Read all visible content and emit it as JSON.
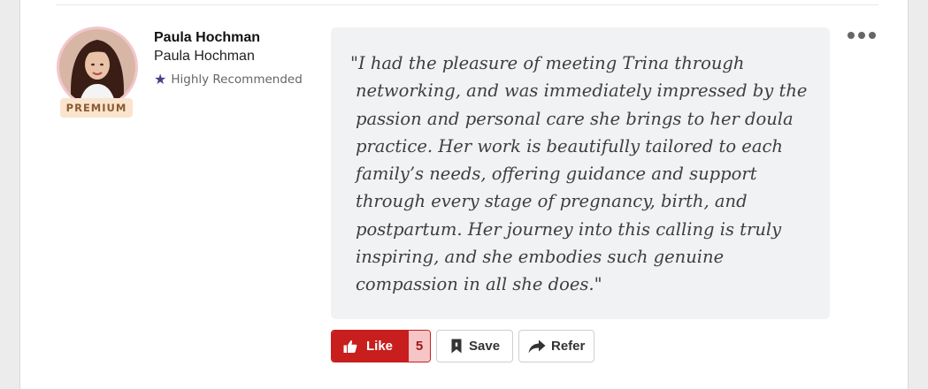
{
  "review": {
    "author_name": "Paula Hochman",
    "author_title": "Paula Hochman",
    "badge": "PREMIUM",
    "recommendation": "Highly Recommended",
    "quote": "\"I had the pleasure of meeting Trina through networking, and was immediately impressed by the passion and personal care she brings to her doula practice. Her work is beautifully tailored to each family’s needs, offering guidance and support through every stage of pregnancy, birth, and postpartum. Her journey into this calling is truly inspiring, and she embodies such genuine compassion in all she does.\""
  },
  "actions": {
    "like_label": "Like",
    "like_count": "5",
    "save_label": "Save",
    "refer_label": "Refer"
  },
  "icons": {
    "recommend": "star-icon",
    "like": "thumbs-up-icon",
    "save": "bookmark-icon",
    "refer": "share-arrow-icon",
    "more": "more-options-icon"
  },
  "colors": {
    "like_bg": "#c81e1e",
    "like_count_bg": "#f6c6c6",
    "quote_bg": "#f1f2f4",
    "premium_bg": "#fbe4cf",
    "star": "#4e3b8c"
  }
}
